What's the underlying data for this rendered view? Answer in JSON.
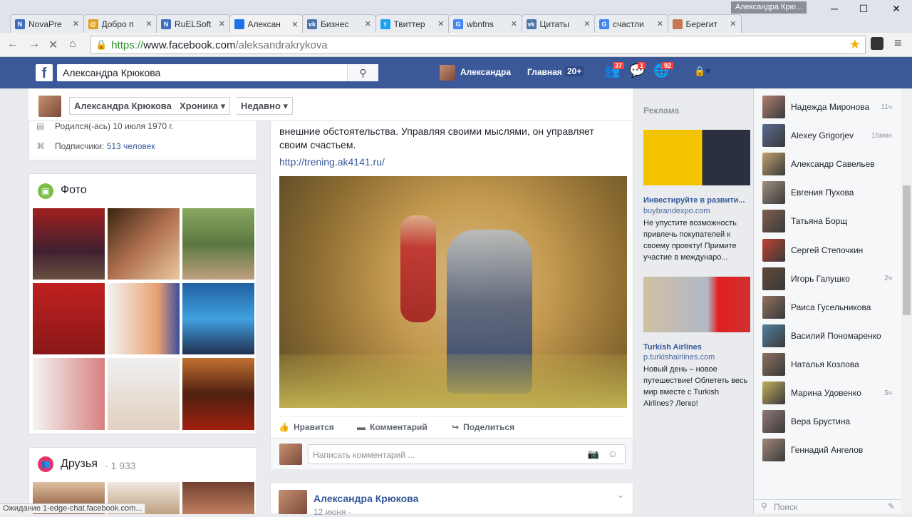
{
  "browser": {
    "tabs": [
      {
        "label": "NovaPre",
        "fav_letter": "N",
        "fav_color": "#3f6cbf"
      },
      {
        "label": "Добро п",
        "fav_letter": "@",
        "fav_color": "#e0a020"
      },
      {
        "label": "RuELSoft",
        "fav_letter": "N",
        "fav_color": "#3f6cbf"
      },
      {
        "label": "Алексан",
        "fav_letter": "",
        "fav_color": "#1a73e8"
      },
      {
        "label": "Бизнес",
        "fav_letter": "vk",
        "fav_color": "#4a76a8"
      },
      {
        "label": "Твиттер",
        "fav_letter": "t",
        "fav_color": "#1da1f2"
      },
      {
        "label": "wbnfns",
        "fav_letter": "G",
        "fav_color": "#4285f4"
      },
      {
        "label": "Цитаты",
        "fav_letter": "vk",
        "fav_color": "#4a76a8"
      },
      {
        "label": "счастли",
        "fav_letter": "G",
        "fav_color": "#4285f4"
      },
      {
        "label": "Берегит",
        "fav_letter": "",
        "fav_color": "#c87850"
      }
    ],
    "user_badge": "Александра Крю...",
    "url_scheme": "https://",
    "url_host": "www.facebook.com",
    "url_path": "/aleksandrakrykova",
    "status_text": "Ожидание 1-edge-chat.facebook.com..."
  },
  "fb": {
    "search_value": "Александра Крюкова",
    "user_short": "Александра",
    "home_label": "Главная",
    "home_count": "20+",
    "friend_requests": "37",
    "messages": "1",
    "notifications": "92"
  },
  "profile": {
    "name": "Александра Крюкова",
    "chronicle": "Хроника",
    "recent": "Недавно"
  },
  "intro": {
    "born": "Родился(-ась) 10 июля 1970 г.",
    "followers_label": "Подписчики:",
    "followers_count": "513 человек"
  },
  "photos": {
    "title": "Фото"
  },
  "friends": {
    "title": "Друзья",
    "count": "· 1 933"
  },
  "post": {
    "text": "внешние обстоятельства. Управляя своими мыслями, он управляет своим счастьем.",
    "link": "http://trening.ak4141.ru/",
    "like": "Нравится",
    "comment": "Комментарий",
    "share": "Поделиться",
    "comment_placeholder": "Написать комментарий ..."
  },
  "post2": {
    "author": "Александра Крюкова",
    "date": "12 июня ·"
  },
  "ads": {
    "header": "Реклама",
    "items": [
      {
        "title": "Инвестируйте в развити...",
        "domain": "buybrandexpo.com",
        "text": "Не упустите возможность привлечь покупателей к своему проекту! Примите участие в междунаро..."
      },
      {
        "title": "Turkish Airlines",
        "domain": "p.turkishairlines.com",
        "text": "Новый день – новое путешествие! Облететь весь мир вместе с Turkish Airlines? Легко!"
      }
    ]
  },
  "chat": {
    "contacts": [
      {
        "name": "Надежда Миронова",
        "time": "11ч"
      },
      {
        "name": "Alexey Grigorjev",
        "time": "15мин"
      },
      {
        "name": "Александр Савельев",
        "time": ""
      },
      {
        "name": "Евгения Пухова",
        "time": ""
      },
      {
        "name": "Татьяна Борщ",
        "time": ""
      },
      {
        "name": "Сергей Степочкин",
        "time": ""
      },
      {
        "name": "Игорь Галушко",
        "time": "2ч"
      },
      {
        "name": "Раиса Гусельникова",
        "time": ""
      },
      {
        "name": "Василий Пономаренко",
        "time": ""
      },
      {
        "name": "Наталья Козлова",
        "time": ""
      },
      {
        "name": "Марина Удовенко",
        "time": "5ч"
      },
      {
        "name": "Вера Брустина",
        "time": ""
      },
      {
        "name": "Геннадий Ангелов",
        "time": ""
      }
    ],
    "search_placeholder": "Поиск"
  }
}
